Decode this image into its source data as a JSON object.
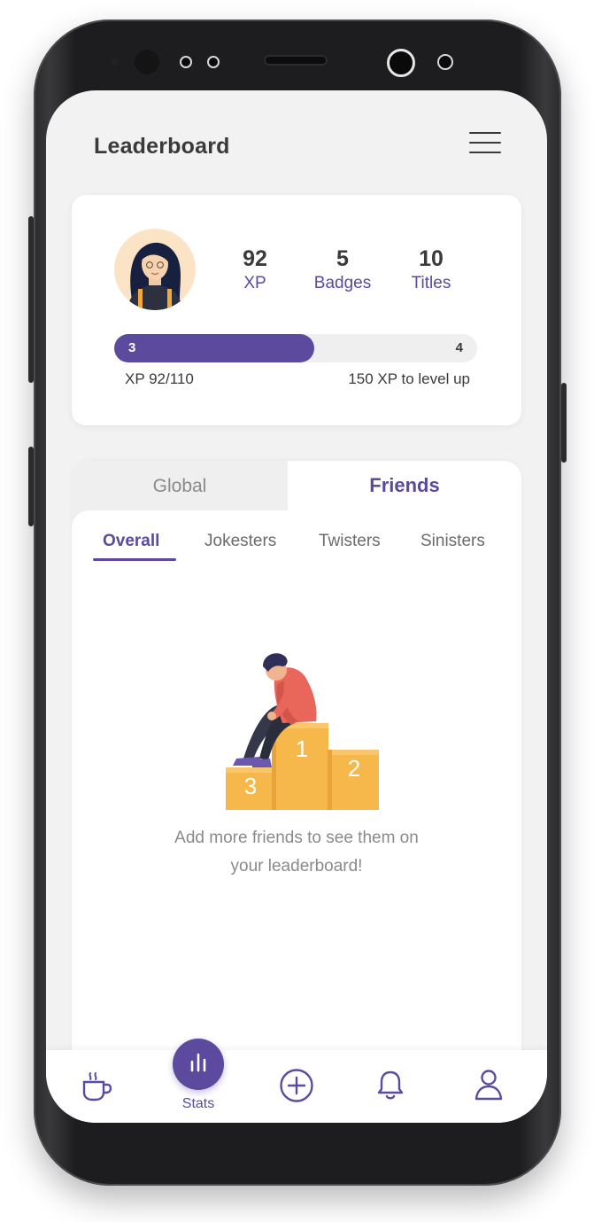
{
  "header": {
    "title": "Leaderboard"
  },
  "profile": {
    "stats": [
      {
        "value": "92",
        "label": "XP"
      },
      {
        "value": "5",
        "label": "Badges"
      },
      {
        "value": "10",
        "label": "Titles"
      }
    ],
    "level_current": "3",
    "level_next": "4",
    "progress_fraction": 0.55,
    "xp_text": "XP 92/110",
    "level_up_text": "150 XP to level up"
  },
  "tabs": {
    "global": "Global",
    "friends": "Friends",
    "active": "Friends"
  },
  "subtabs": {
    "items": [
      "Overall",
      "Jokesters",
      "Twisters",
      "Sinisters"
    ],
    "active": "Overall"
  },
  "podium": {
    "first": "1",
    "second": "2",
    "third": "3"
  },
  "empty_state": {
    "line1": "Add more friends to see them on",
    "line2": "your leaderboard!"
  },
  "nav": {
    "items": [
      {
        "icon": "coffee-cup-icon"
      },
      {
        "icon": "stats-chart-icon",
        "label": "Stats",
        "active": true
      },
      {
        "icon": "plus-circle-icon"
      },
      {
        "icon": "bell-icon"
      },
      {
        "icon": "user-icon"
      }
    ]
  },
  "colors": {
    "accent": "#5b4a9e",
    "podium": "#f7b84b",
    "text": "#3a3a3a"
  }
}
